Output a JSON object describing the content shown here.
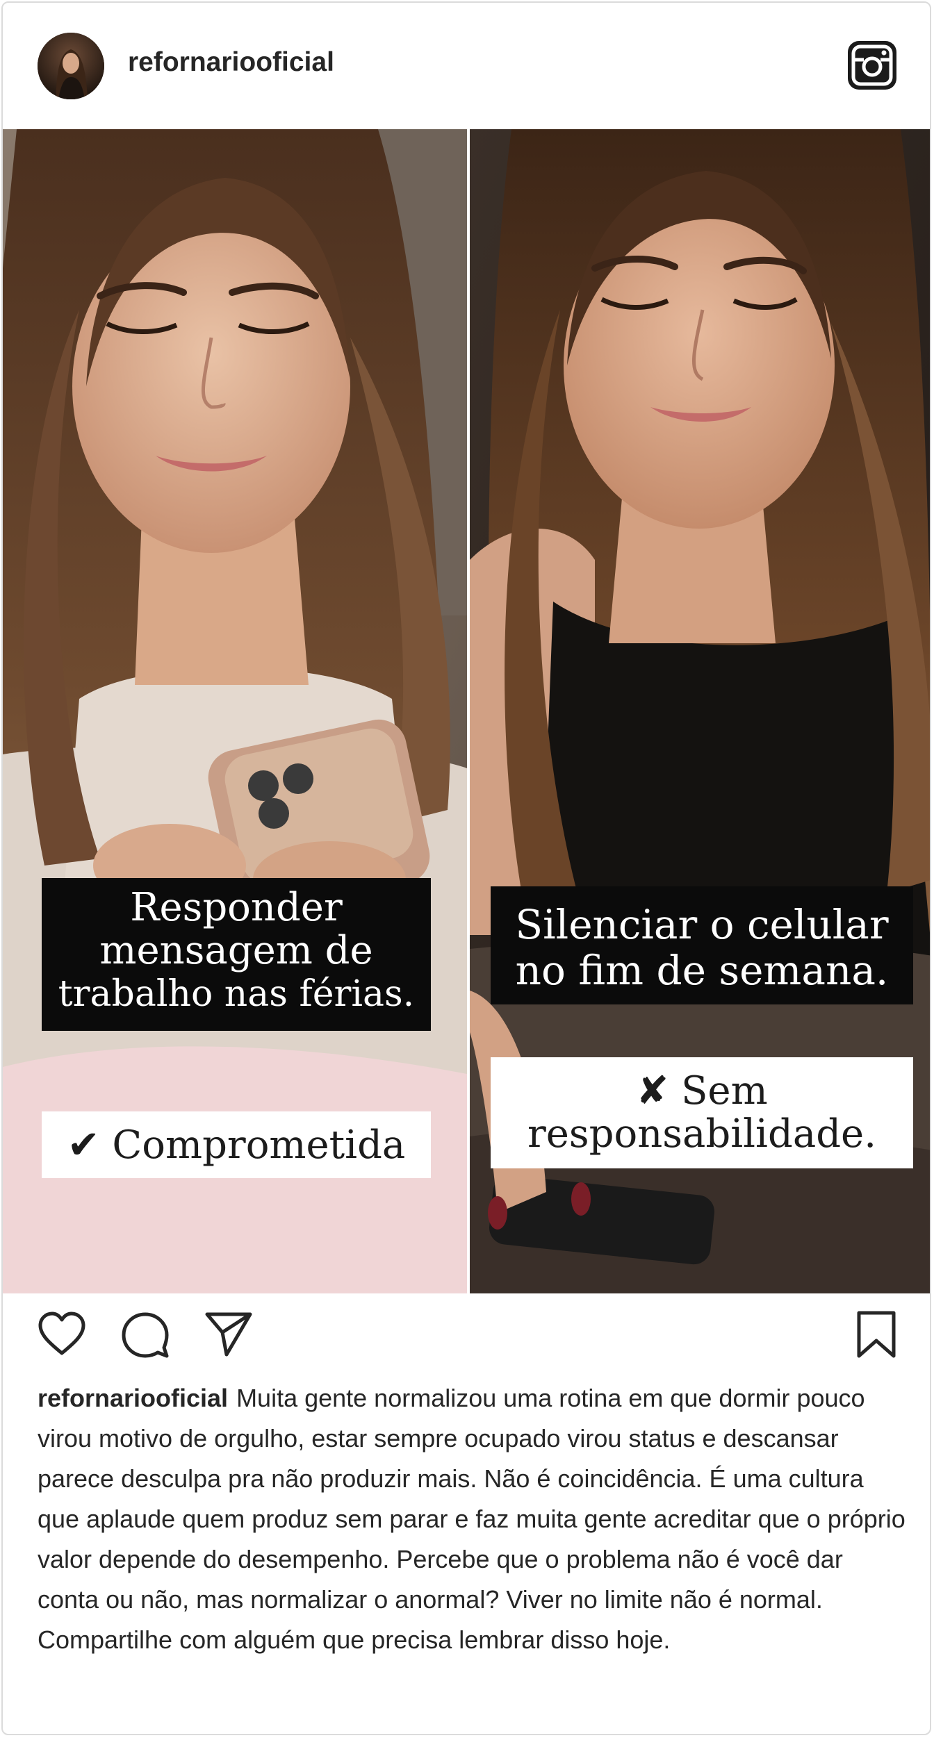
{
  "post": {
    "username": "refornariooficial",
    "avatar_icon": "profile-photo",
    "platform_icon": "instagram-icon"
  },
  "image": {
    "left_panel": {
      "statement": "Responder mensagem de trabalho nas férias.",
      "statement_lines": [
        "Responder",
        "mensagem de",
        "trabalho nas férias."
      ],
      "verdict_icon": "✔",
      "verdict": "Comprometida"
    },
    "right_panel": {
      "statement_lines": [
        "Silenciar o celular",
        "no fim de semana."
      ],
      "verdict_icon": "✘",
      "verdict_lines": [
        "Sem",
        "responsabilidade."
      ]
    }
  },
  "actions": {
    "like_icon": "heart-icon",
    "comment_icon": "comment-icon",
    "share_icon": "send-icon",
    "save_icon": "bookmark-icon"
  },
  "caption": {
    "username": "refornariooficial",
    "text": "Muita gente normalizou uma rotina em que dormir pouco virou motivo de orgulho, estar sempre ocupado virou status e descansar parece desculpa pra não produzir mais. Não é coincidência. É uma cultura que aplaude quem produz sem parar e faz muita gente acreditar que o próprio valor depende do desempenho. Percebe que o problema não é você dar conta ou não, mas normalizar o anormal? Viver no limite não é normal. Compartilhe com alguém que precisa lembrar disso hoje."
  },
  "colors": {
    "text": "#262626",
    "border": "#dbdbdb",
    "tag_black": "#0b0b0b",
    "tag_white": "#ffffff"
  }
}
